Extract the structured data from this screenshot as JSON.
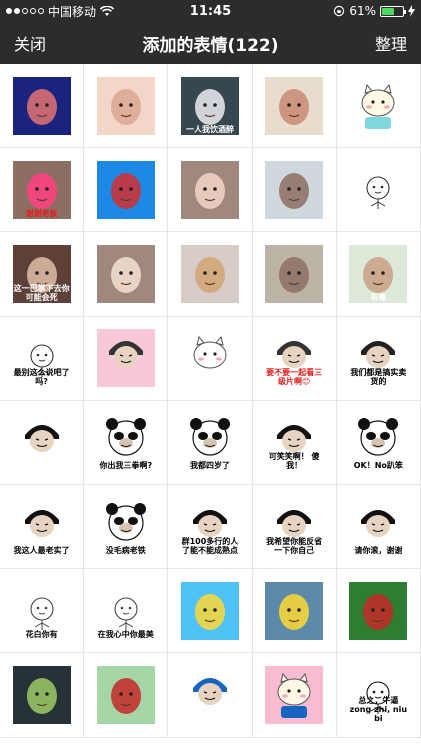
{
  "status": {
    "carrier": "中国移动",
    "time": "11:45",
    "battery": "61%",
    "battery_level": 0.61
  },
  "nav": {
    "close": "关闭",
    "title": "添加的表情(122)",
    "organize": "整理"
  },
  "stickers": [
    {
      "kind": "photo",
      "bg": "#1a237e",
      "fg": "#e57373",
      "caption": ""
    },
    {
      "kind": "photo",
      "bg": "#f3d6c7",
      "fg": "#d8a892",
      "caption": ""
    },
    {
      "kind": "photo",
      "bg": "#37474f",
      "fg": "#eceff1",
      "caption": "一人我饮酒醉"
    },
    {
      "kind": "photo",
      "bg": "#e8dccf",
      "fg": "#c98a72",
      "caption": ""
    },
    {
      "kind": "cartoon",
      "bg": "#ffffff",
      "fg": "#7ed6df",
      "caption": ""
    },
    {
      "kind": "photo",
      "bg": "#8d6e63",
      "fg": "#ff4081",
      "caption": "谢谢老板"
    },
    {
      "kind": "photo",
      "bg": "#1e88e5",
      "fg": "#d32f2f",
      "caption": ""
    },
    {
      "kind": "photo",
      "bg": "#a1887f",
      "fg": "#f3d6c7",
      "caption": ""
    },
    {
      "kind": "photo",
      "bg": "#cfd8dc",
      "fg": "#8d6e63",
      "caption": ""
    },
    {
      "kind": "doodle",
      "bg": "#ffffff",
      "fg": "#333333",
      "caption": ""
    },
    {
      "kind": "photo",
      "bg": "#5d4037",
      "fg": "#e0c0a8",
      "caption": "这一巴掌下去你可能会死"
    },
    {
      "kind": "photo",
      "bg": "#a1887f",
      "fg": "#f5e0d0",
      "caption": ""
    },
    {
      "kind": "photo",
      "bg": "#d7ccc8",
      "fg": "#d4a574",
      "caption": ""
    },
    {
      "kind": "photo",
      "bg": "#bdb4a8",
      "fg": "#8d6e63",
      "caption": ""
    },
    {
      "kind": "photo",
      "bg": "#dce8d8",
      "fg": "#c9a085",
      "caption": "有毒"
    },
    {
      "kind": "doodle",
      "bg": "#ffffff",
      "fg": "#333333",
      "caption": "最别这么说吧了吗?"
    },
    {
      "kind": "meme",
      "bg": "#f8c8d8",
      "fg": "#333333",
      "caption": ""
    },
    {
      "kind": "cartoon",
      "bg": "#ffffff",
      "fg": "#ffffff",
      "caption": ""
    },
    {
      "kind": "meme",
      "bg": "#ffffff",
      "fg": "#333333",
      "caption": "要不要一起看三级片啊😊"
    },
    {
      "kind": "meme",
      "bg": "#ffffff",
      "fg": "#222222",
      "caption": "我们都是搞实卖货的"
    },
    {
      "kind": "meme",
      "bg": "#ffffff",
      "fg": "#111111",
      "caption": ""
    },
    {
      "kind": "panda",
      "bg": "#ffffff",
      "fg": "#111111",
      "caption": "你出我三拳啊?"
    },
    {
      "kind": "panda",
      "bg": "#ffffff",
      "fg": "#111111",
      "caption": "我都四岁了"
    },
    {
      "kind": "meme",
      "bg": "#ffffff",
      "fg": "#111111",
      "caption": "可笑笑啊！ 傻我！"
    },
    {
      "kind": "panda",
      "bg": "#ffffff",
      "fg": "#111111",
      "caption": "OK！No趴笨"
    },
    {
      "kind": "meme",
      "bg": "#ffffff",
      "fg": "#111111",
      "caption": "我这人最老实了"
    },
    {
      "kind": "panda",
      "bg": "#ffffff",
      "fg": "#111111",
      "caption": "没毛病老铁"
    },
    {
      "kind": "meme",
      "bg": "#ffffff",
      "fg": "#111111",
      "caption": "群100多行的人了能不能成熟点"
    },
    {
      "kind": "meme",
      "bg": "#ffffff",
      "fg": "#111111",
      "caption": "我希望你能反省一下你自己"
    },
    {
      "kind": "meme",
      "bg": "#ffffff",
      "fg": "#111111",
      "caption": "请你滚，谢谢"
    },
    {
      "kind": "doodle",
      "bg": "#ffffff",
      "fg": "#444444",
      "caption": "花白你有"
    },
    {
      "kind": "doodle",
      "bg": "#ffffff",
      "fg": "#444444",
      "caption": "在我心中你最美"
    },
    {
      "kind": "photo",
      "bg": "#4fc3f7",
      "fg": "#fdd835",
      "caption": ""
    },
    {
      "kind": "photo",
      "bg": "#5d8aa8",
      "fg": "#fdd835",
      "caption": ""
    },
    {
      "kind": "photo",
      "bg": "#2e7d32",
      "fg": "#c62828",
      "caption": ""
    },
    {
      "kind": "photo",
      "bg": "#263238",
      "fg": "#9ccc65",
      "caption": ""
    },
    {
      "kind": "photo",
      "bg": "#a5d6a7",
      "fg": "#c62828",
      "caption": ""
    },
    {
      "kind": "meme",
      "bg": "#ffffff",
      "fg": "#1565c0",
      "caption": ""
    },
    {
      "kind": "cartoon",
      "bg": "#f8bbd0",
      "fg": "#1565c0",
      "caption": ""
    },
    {
      "kind": "doodle",
      "bg": "#ffffff",
      "fg": "#111111",
      "caption": "总之，牛逼 zong zhi, niu bi"
    }
  ]
}
